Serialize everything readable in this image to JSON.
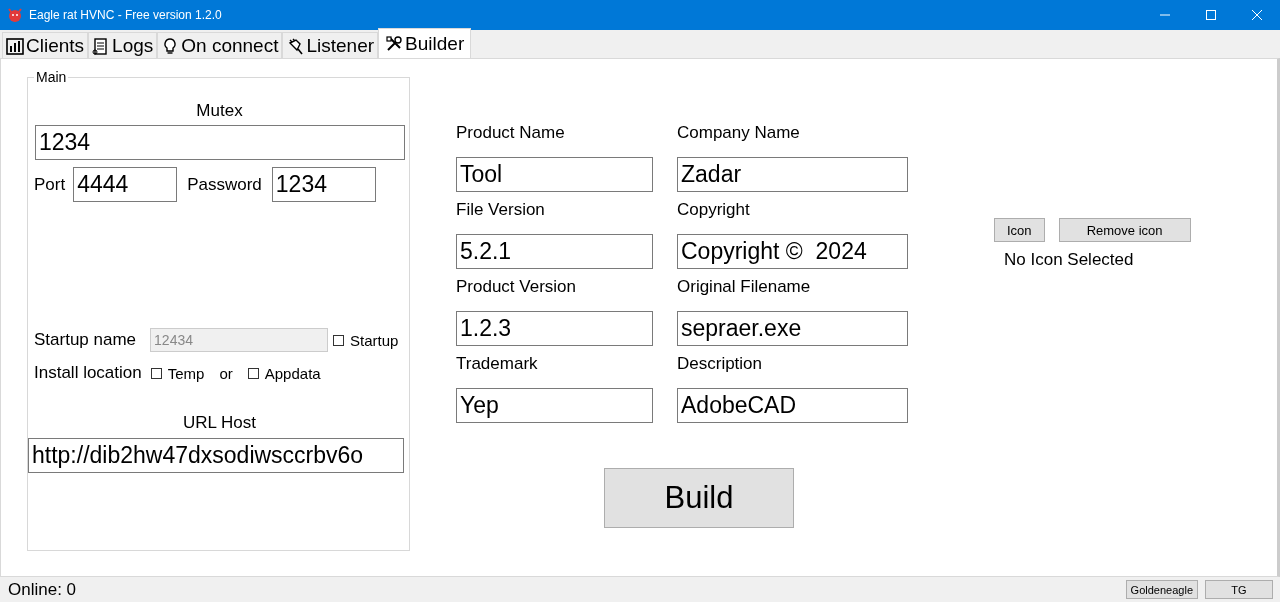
{
  "window": {
    "title": "Eagle rat HVNC - Free version 1.2.0"
  },
  "tabs": [
    {
      "label": "Clients",
      "selected": false
    },
    {
      "label": "Logs",
      "selected": false
    },
    {
      "label": "On connect",
      "selected": false
    },
    {
      "label": "Listener",
      "selected": false
    },
    {
      "label": "Builder",
      "selected": true
    }
  ],
  "main_group": {
    "title": "Main",
    "mutex_label": "Mutex",
    "mutex": "1234",
    "port_label": "Port",
    "port": "4444",
    "password_label": "Password",
    "password": "1234",
    "startup_name_label": "Startup name",
    "startup_name": {
      "value": "12434",
      "disabled": true
    },
    "startup": {
      "label": "Startup",
      "checked": false
    },
    "install_label": "Install location",
    "temp": {
      "label": "Temp",
      "checked": false
    },
    "or_label": "or",
    "appdata": {
      "label": "Appdata",
      "checked": false
    },
    "url_label": "URL Host",
    "url": "http://dib2hw47dxsodiwsccrbv6o"
  },
  "assembly_fields": [
    {
      "label": "Product Name",
      "value": "Tool"
    },
    {
      "label": "Company Name",
      "value": "Zadar"
    },
    {
      "label": "File Version",
      "value": "5.2.1"
    },
    {
      "label": "Copyright",
      "value": "Copyright ©  2024"
    },
    {
      "label": "Product Version",
      "value": "1.2.3"
    },
    {
      "label": "Original Filename",
      "value": "sepraer.exe"
    },
    {
      "label": "Trademark",
      "value": "Yep"
    },
    {
      "label": "Description",
      "value": "AdobeCAD"
    }
  ],
  "build_button": "Build",
  "icon_panel": {
    "buttons": [
      "Icon",
      "Remove icon"
    ],
    "status": "No Icon Selected"
  },
  "status_bar": {
    "online": "Online: 0",
    "buttons": [
      "Goldeneagle",
      "TG"
    ]
  }
}
